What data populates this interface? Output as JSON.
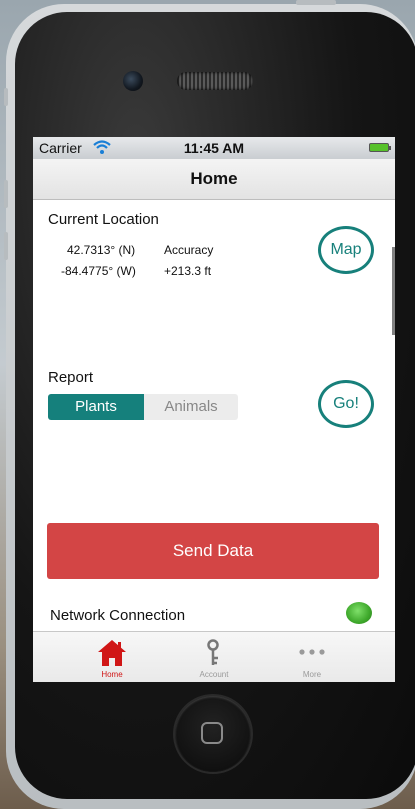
{
  "status_bar": {
    "carrier": "Carrier",
    "time": "11:45 AM"
  },
  "nav": {
    "title": "Home"
  },
  "location": {
    "section_label": "Current Location",
    "latitude": "42.7313° (N)",
    "longitude": "-84.4775° (W)",
    "accuracy_label": "Accuracy",
    "accuracy_value": "+213.3 ft",
    "map_button": "Map"
  },
  "report": {
    "section_label": "Report",
    "segments": [
      {
        "label": "Plants",
        "selected": true
      },
      {
        "label": "Animals",
        "selected": false
      }
    ],
    "go_button": "Go!"
  },
  "send_button": "Send Data",
  "network": {
    "label": "Network Connection",
    "status_color": "#3ea82b"
  },
  "tabs": [
    {
      "label": "Home",
      "icon": "house-icon",
      "active": true
    },
    {
      "label": "Account",
      "icon": "key-icon",
      "active": false
    },
    {
      "label": "More",
      "icon": "more-dots-icon",
      "active": false
    }
  ],
  "colors": {
    "accent": "#17807b",
    "send": "#d34545",
    "active_tab": "#d01616"
  }
}
